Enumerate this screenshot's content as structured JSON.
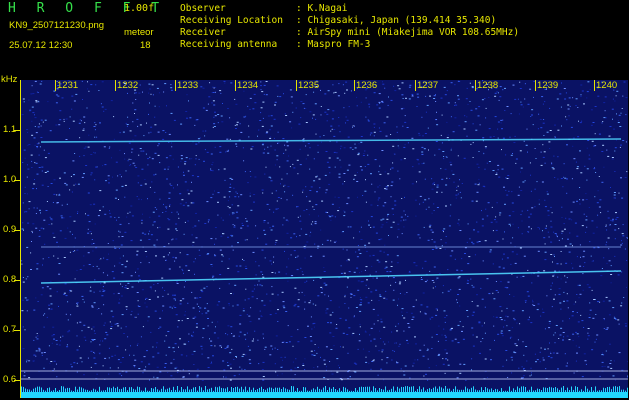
{
  "app": {
    "name": "H R O F F T",
    "version": "1.00f"
  },
  "file": {
    "name": "KN9_2507121230.png",
    "datetime": "25.07.12 12:30"
  },
  "meteor": {
    "label": "meteor",
    "count": "18"
  },
  "info": [
    {
      "key": "Observer",
      "value": ": K.Nagai"
    },
    {
      "key": "Receiving Location",
      "value": ": Chigasaki, Japan (139.414 35.340)"
    },
    {
      "key": "Receiver",
      "value": ": AirSpy mini (Miakejima VOR 108.65MHz)"
    },
    {
      "key": "Receiving antenna",
      "value": ": Maspro FM-3"
    }
  ],
  "axis": {
    "unit": "kHz",
    "y_ticks": [
      "1.1",
      "1.0",
      "0.9",
      "0.8",
      "0.7",
      "0.6"
    ],
    "x_ticks": [
      "1231",
      "1232",
      "1233",
      "1234",
      "1235",
      "1236",
      "1237",
      "1238",
      "1239",
      "1240"
    ]
  },
  "colors": {
    "text": "#e6e600",
    "title": "#35e04a",
    "background": "#0a1264",
    "carrier": "#4fd7ff"
  }
}
